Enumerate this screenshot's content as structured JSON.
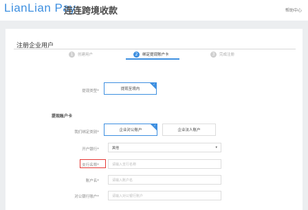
{
  "header": {
    "logo_text": "LianLian Pay",
    "brand_cn": "连连跨境收款",
    "help_label": "帮助中心"
  },
  "page": {
    "title": "注册企业用户",
    "steps": [
      {
        "num": "1",
        "label": "创建用户",
        "active": false
      },
      {
        "num": "2",
        "label": "绑定提现账户卡",
        "active": true
      },
      {
        "num": "3",
        "label": "完成注册",
        "active": false
      }
    ]
  },
  "form": {
    "withdraw_type_label": "提现类型*",
    "withdraw_type_value": "提现至境内",
    "section_title": "提现账户卡",
    "bind_method_label": "我们绑定类别*",
    "bind_options": [
      "企业对公账户",
      "企业法人账户"
    ],
    "bank_label": "开户银行*",
    "bank_value": "其他",
    "branch_label": "支行名称*",
    "branch_placeholder": "请输入支行名称",
    "account_name_label": "账户名*",
    "account_name_placeholder": "请输入账户名",
    "account_no_label": "对公银行账户*",
    "account_no_placeholder": "请输入对公银行账户"
  },
  "colors": {
    "brand": "#3d8fe0",
    "highlight": "#e53935"
  }
}
